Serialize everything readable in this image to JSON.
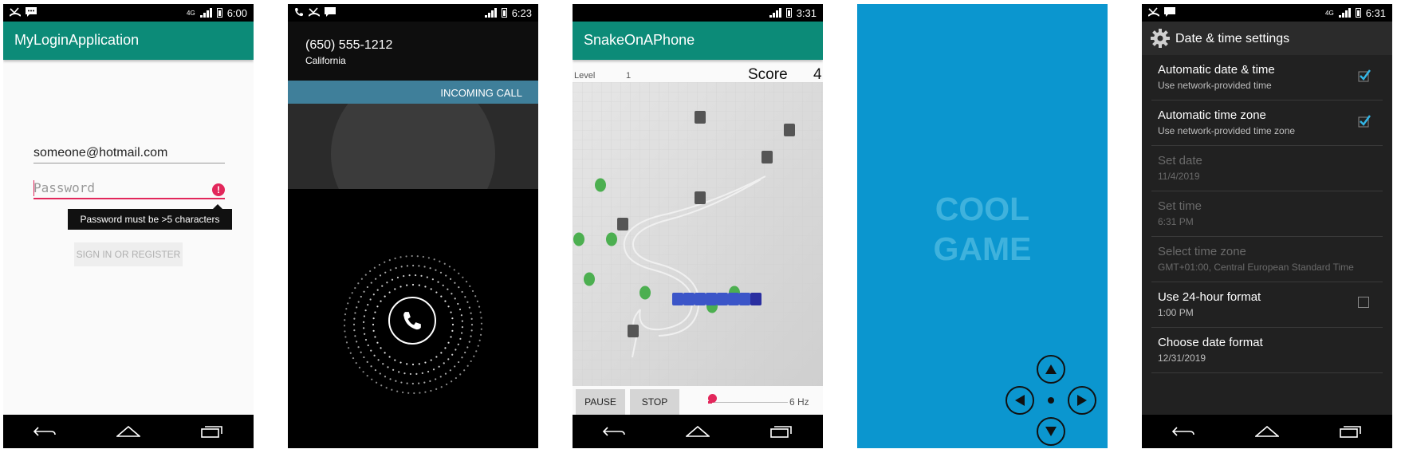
{
  "phone1": {
    "status": {
      "time": "6:00",
      "network": "4G"
    },
    "appbar_title": "MyLoginApplication",
    "email_value": "someone@hotmail.com",
    "password_placeholder": "Password",
    "error_icon": "!",
    "tooltip": "Password must be >5 characters",
    "signin_label": "SIGN IN OR REGISTER"
  },
  "phone2": {
    "status": {
      "time": "6:23"
    },
    "caller_number": "(650) 555-1212",
    "caller_location": "California",
    "incoming_label": "INCOMING CALL"
  },
  "phone3": {
    "status": {
      "time": "3:31"
    },
    "appbar_title": "SnakeOnAPhone",
    "level_label": "Level",
    "level_value": "1",
    "score_label": "Score",
    "score_value": "4",
    "pause_label": "PAUSE",
    "stop_label": "STOP",
    "speed_label": "6 Hz",
    "speed_fraction": 0.05
  },
  "phone4": {
    "title_line1": "COOL",
    "title_line2": "GAME"
  },
  "phone5": {
    "status": {
      "time": "6:31",
      "network": "4G"
    },
    "header_title": "Date & time settings",
    "rows": [
      {
        "title": "Automatic date & time",
        "subtitle": "Use network-provided time",
        "checkbox": "checked"
      },
      {
        "title": "Automatic time zone",
        "subtitle": "Use network-provided time zone",
        "checkbox": "checked"
      },
      {
        "title": "Set date",
        "subtitle": "11/4/2019",
        "checkbox": "none",
        "disabled": true
      },
      {
        "title": "Set time",
        "subtitle": "6:31 PM",
        "checkbox": "none",
        "disabled": true
      },
      {
        "title": "Select time zone",
        "subtitle": "GMT+01:00, Central European Standard Time",
        "checkbox": "none",
        "disabled": true
      },
      {
        "title": "Use 24-hour format",
        "subtitle": "1:00 PM",
        "checkbox": "unchecked"
      },
      {
        "title": "Choose date format",
        "subtitle": "12/31/2019",
        "checkbox": "none"
      }
    ]
  },
  "colors": {
    "teal_appbar": "#0c8b78",
    "error_pink": "#e2275b",
    "incoming_blue": "#3f7f9a",
    "game_blue": "#0b96cf",
    "snake_blue": "#3b55c8",
    "food_green": "#4caf50",
    "checkbox_blue": "#33b5e5"
  }
}
